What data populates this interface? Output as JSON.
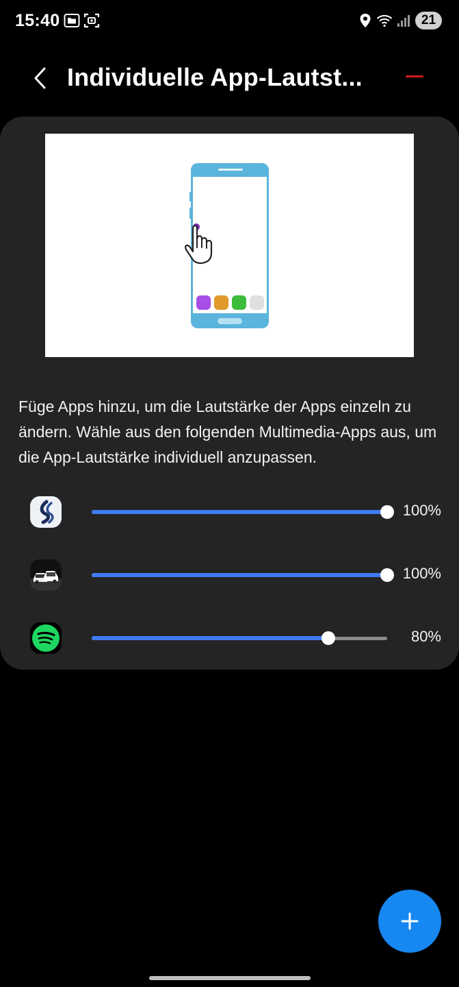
{
  "status_bar": {
    "time": "15:40",
    "battery_level": "21",
    "icons": [
      "folder-icon",
      "screenshot-icon",
      "location-icon",
      "wifi-icon",
      "signal-icon"
    ]
  },
  "header": {
    "title": "Individuelle App-Lautst...",
    "back_icon": "chevron-left-icon"
  },
  "illustration": {
    "description_icons": [
      "phone-illustration",
      "hand-pointer-icon"
    ],
    "app_dot_colors": [
      "#a84ee8",
      "#e09a2a",
      "#3dbb3a",
      "#e0e0e0"
    ]
  },
  "description": "Füge Apps hinzu, um die Lautstärke der Apps einzeln zu ändern. Wähle aus den folgenden Multimedia-Apps aus, um die App-Lautstärke individuell anzupassen.",
  "apps": [
    {
      "icon": "navigation-app-icon",
      "level": 1.0,
      "label": "100%"
    },
    {
      "icon": "car-app-icon",
      "level": 1.0,
      "label": "100%"
    },
    {
      "icon": "spotify-icon",
      "level": 0.8,
      "label": "80%"
    }
  ],
  "fab": {
    "icon": "plus-icon"
  },
  "colors": {
    "accent": "#3e7bef",
    "fab": "#1787f2",
    "card": "#242424",
    "header_dash": "#d11a1a",
    "spotify": "#1ed760"
  }
}
